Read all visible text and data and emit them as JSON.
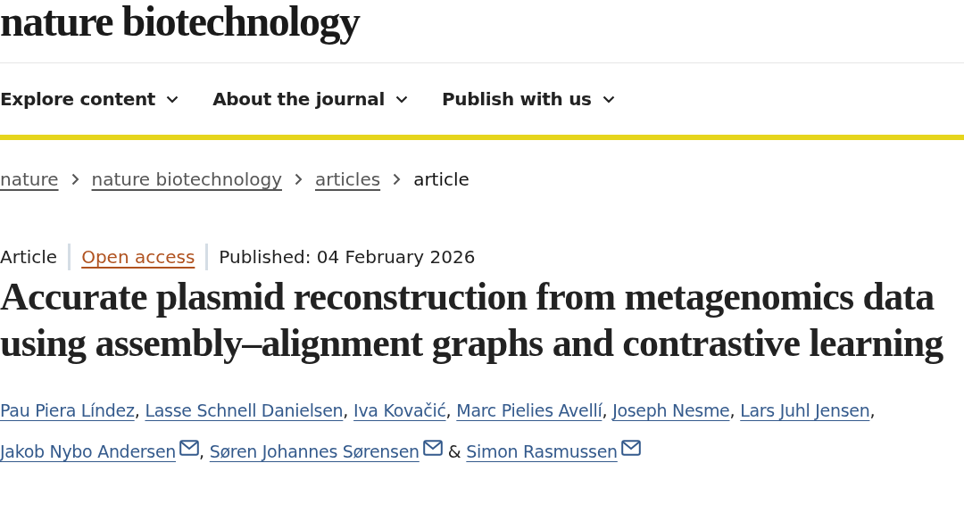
{
  "header": {
    "logo": "nature biotechnology"
  },
  "nav": [
    {
      "label": "Explore content"
    },
    {
      "label": "About the journal"
    },
    {
      "label": "Publish with us"
    }
  ],
  "breadcrumbs": [
    {
      "label": "nature",
      "current": false
    },
    {
      "label": "nature biotechnology",
      "current": false
    },
    {
      "label": "articles",
      "current": false
    },
    {
      "label": "article",
      "current": true
    }
  ],
  "article": {
    "type": "Article",
    "access": "Open access",
    "published": "Published: 04 February 2026",
    "title": "Accurate plasmid reconstruction from metagenomics data using assembly–alignment graphs and contrastive learning",
    "authors": [
      {
        "name": "Pau Piera Líndez",
        "email": false,
        "separator": ","
      },
      {
        "name": "Lasse Schnell Danielsen",
        "email": false,
        "separator": ","
      },
      {
        "name": "Iva Kovačić",
        "email": false,
        "separator": ","
      },
      {
        "name": "Marc Pielies Avellí",
        "email": false,
        "separator": ","
      },
      {
        "name": "Joseph Nesme",
        "email": false,
        "separator": ","
      },
      {
        "name": "Lars Juhl Jensen",
        "email": false,
        "separator": ","
      },
      {
        "name": "Jakob Nybo Andersen",
        "email": true,
        "separator": ","
      },
      {
        "name": "Søren Johannes Sørensen",
        "email": true,
        "separator": "&"
      },
      {
        "name": "Simon Rasmussen",
        "email": true
      }
    ]
  }
}
